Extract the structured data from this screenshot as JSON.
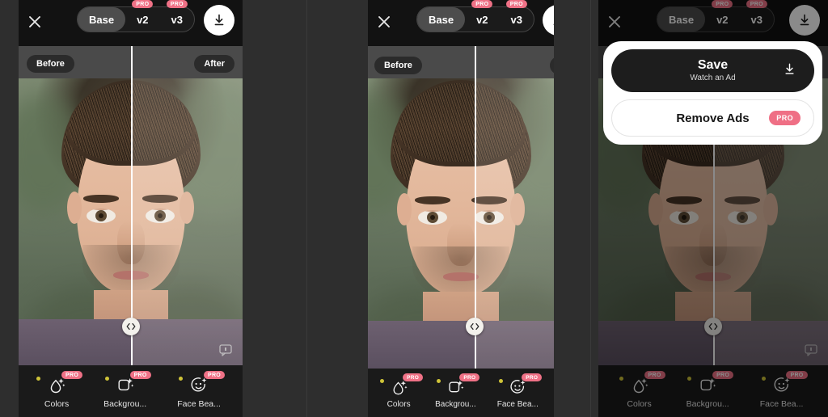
{
  "app": {
    "accent_pink": "#ef7186",
    "panel_bg": "#1a1a1a",
    "header_bg": "#121212",
    "dot_yellow": "#cfc438"
  },
  "header": {
    "close_icon": "close-x-icon",
    "download_icon": "download-arrow-icon",
    "segments": [
      {
        "label": "Base",
        "pro": false,
        "active": true
      },
      {
        "label": "v2",
        "pro": true,
        "pro_label": "PRO",
        "active": false
      },
      {
        "label": "v3",
        "pro": true,
        "pro_label": "PRO",
        "active": false
      }
    ]
  },
  "compare": {
    "before_label": "Before",
    "after_label": "After",
    "handle_icon": "left-right-chevrons-icon",
    "feedback_icon": "feedback-comment-icon"
  },
  "toolbar": {
    "tools": [
      {
        "label": "Colors",
        "icon": "color-droplet-sparkle-icon",
        "pro_label": "PRO",
        "has_dot": true
      },
      {
        "label": "Backgrou...",
        "icon": "background-photo-sparkle-icon",
        "pro_label": "PRO",
        "has_dot": true
      },
      {
        "label": "Face Bea...",
        "icon": "face-smile-sparkle-icon",
        "pro_label": "PRO",
        "has_dot": true
      }
    ]
  },
  "sheet": {
    "save_title": "Save",
    "save_subtitle": "Watch an Ad",
    "save_icon": "download-arrow-icon",
    "remove_ads_label": "Remove Ads",
    "remove_ads_pro": "PRO"
  }
}
